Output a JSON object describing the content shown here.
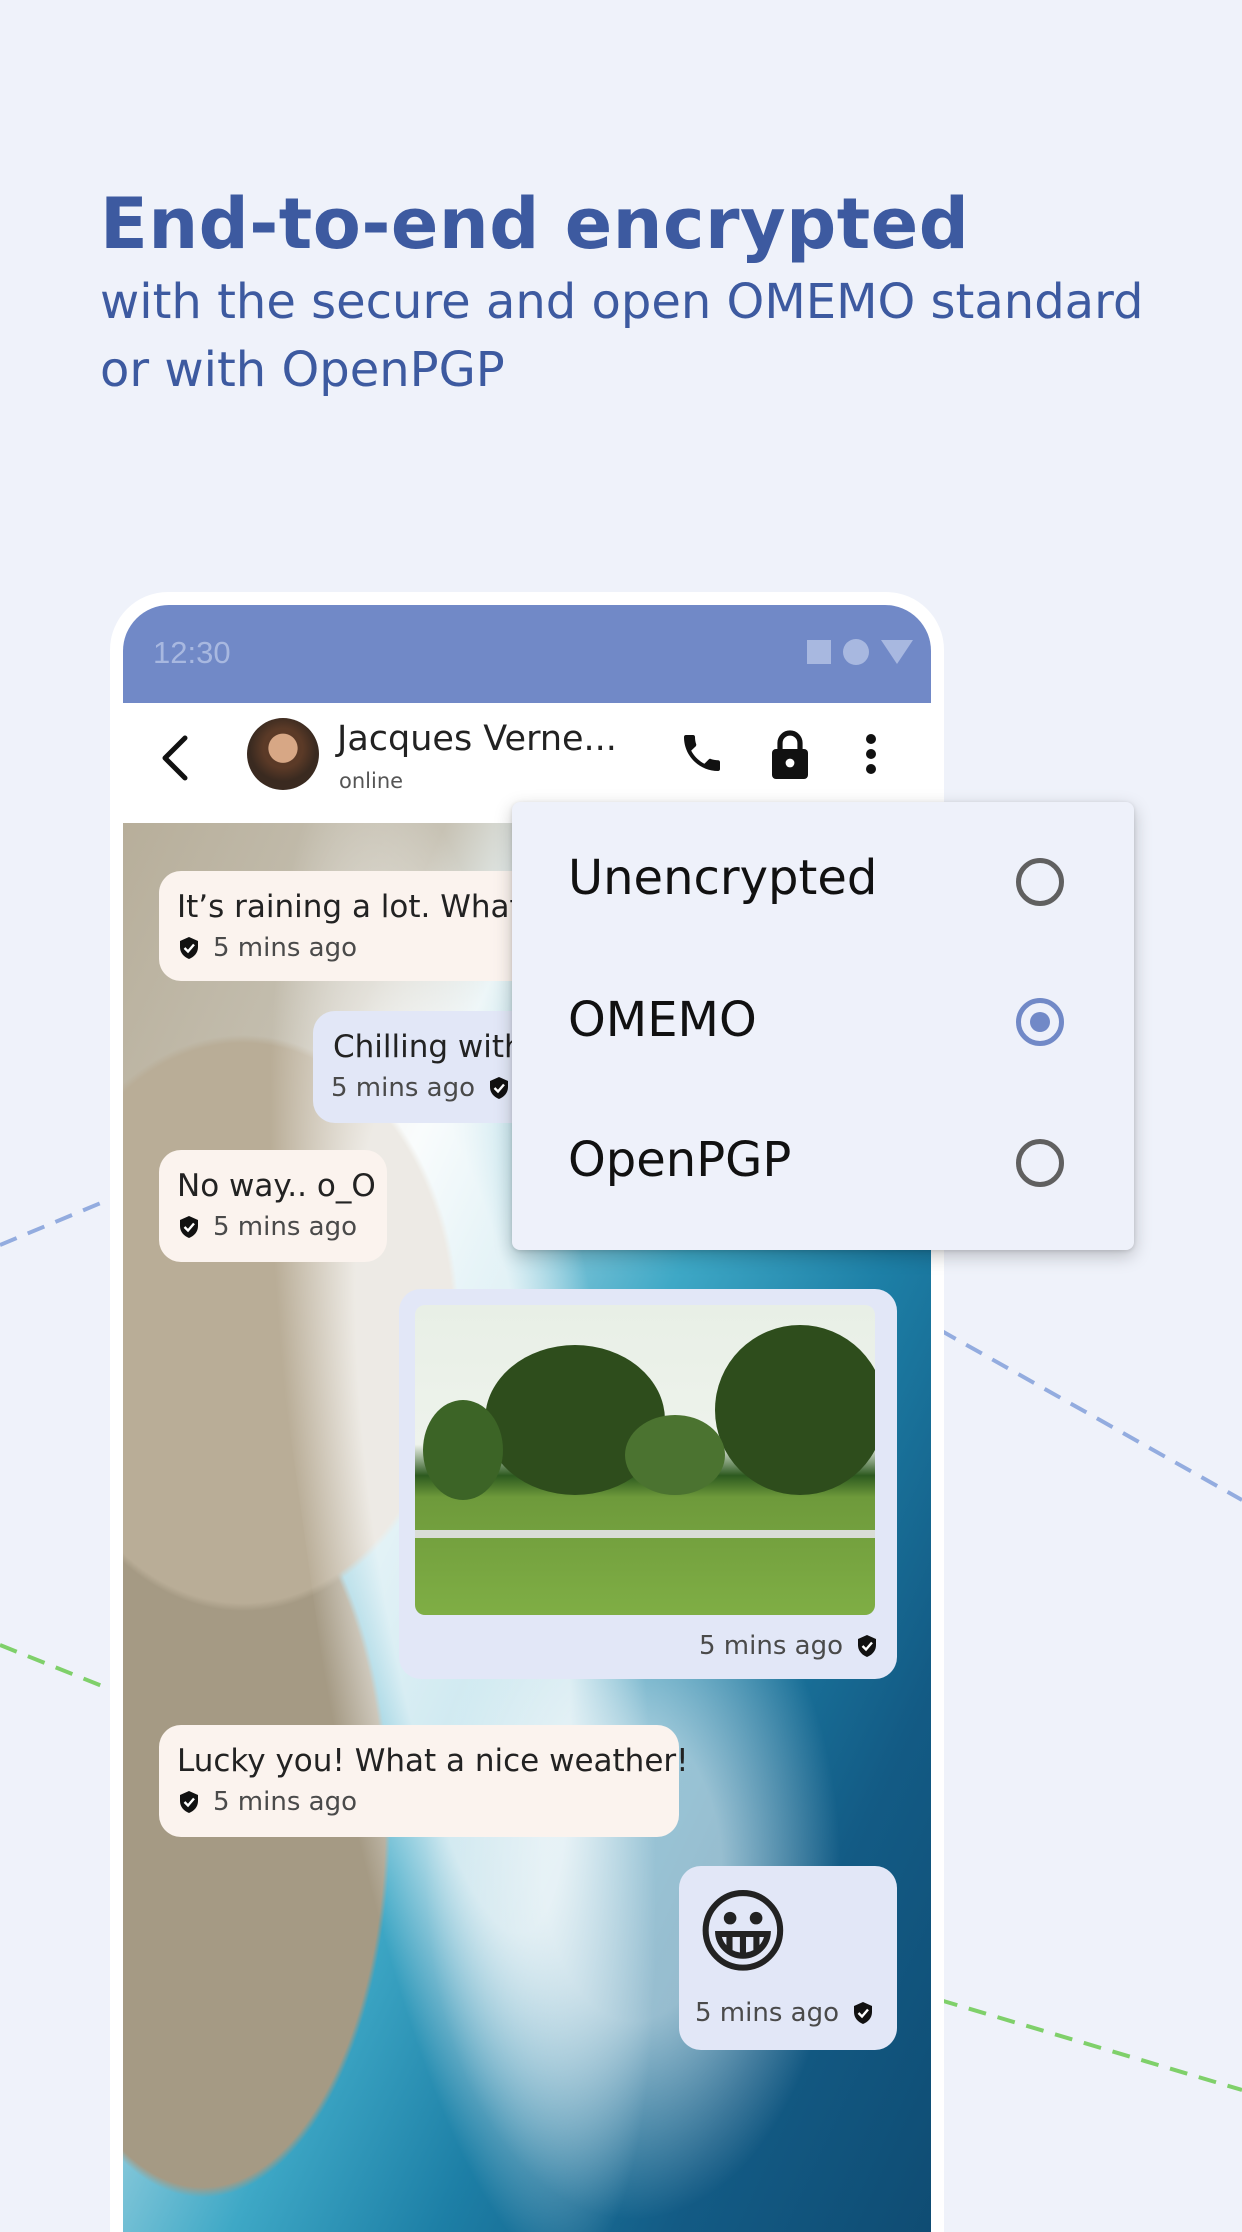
{
  "headline": {
    "title": "End-to-end encrypted",
    "subtitle_line1": "with the secure and open OMEMO standard",
    "subtitle_line2": "or with OpenPGP"
  },
  "status_bar": {
    "time": "12:30"
  },
  "toolbar": {
    "contact_name": "Jacques Verne...",
    "contact_status": "online",
    "icons": [
      "back-arrow-icon",
      "call-icon",
      "lock-icon",
      "more-vert-icon"
    ]
  },
  "messages": [
    {
      "direction": "incoming",
      "text": "It’s raining a lot. What",
      "time": "5 mins ago"
    },
    {
      "direction": "outgoing",
      "text": "Chilling with",
      "time": "5 mins ago"
    },
    {
      "direction": "incoming",
      "text": "No way.. o_O",
      "time": "5 mins ago"
    },
    {
      "direction": "outgoing",
      "type": "image",
      "time": "5 mins ago"
    },
    {
      "direction": "incoming",
      "text": "Lucky you! What a nice weather!",
      "time": "5 mins ago"
    },
    {
      "direction": "outgoing",
      "text": "😀",
      "time": "5 mins ago"
    }
  ],
  "encryption_menu": {
    "options": [
      {
        "label": "Unencrypted",
        "selected": false
      },
      {
        "label": "OMEMO",
        "selected": true
      },
      {
        "label": "OpenPGP",
        "selected": false
      }
    ]
  },
  "colors": {
    "accent": "#3d5aa0",
    "status_bar": "#7189c7",
    "background": "#eff2fa",
    "incoming_bubble": "#fbf3ee",
    "outgoing_bubble": "#e2e7f7"
  }
}
